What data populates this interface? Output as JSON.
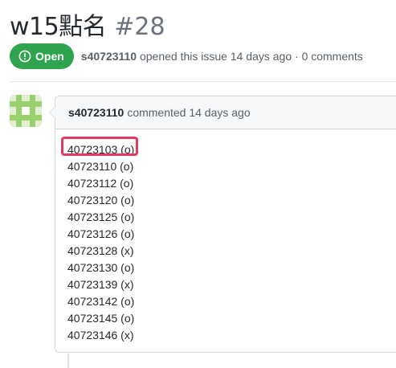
{
  "issue": {
    "title": "w15點名",
    "number": "#28",
    "state_label": "Open",
    "author": "s40723110",
    "meta_rest": "opened this issue 14 days ago · 0 comments"
  },
  "comment": {
    "author": "s40723110",
    "meta": "commented 14 days ago",
    "lines": [
      "40723103 (o)",
      "40723110 (o)",
      "40723112 (o)",
      "40723120 (o)",
      "40723125 (o)",
      "40723126 (o)",
      "40723128 (x)",
      "40723130 (o)",
      "40723139 (x)",
      "40723142 (o)",
      "40723145 (o)",
      "40723146 (x)"
    ]
  },
  "colors": {
    "open_green": "#2ea44f",
    "highlight": "#e53a60",
    "avatar_green": "#9ccf6e"
  },
  "icons": {
    "state": "issue-opened-icon",
    "avatar": "identicon-avatar"
  }
}
